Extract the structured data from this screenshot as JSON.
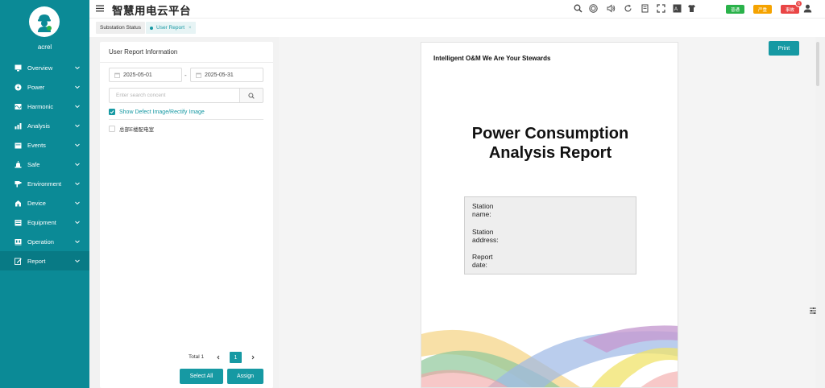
{
  "sidebar": {
    "username": "acrel",
    "items": [
      {
        "label": "Overview",
        "icon": "monitor-icon"
      },
      {
        "label": "Power",
        "icon": "power-icon"
      },
      {
        "label": "Harmonic",
        "icon": "harmonic-icon"
      },
      {
        "label": "Analysis",
        "icon": "bar-chart-icon"
      },
      {
        "label": "Events",
        "icon": "calendar-icon"
      },
      {
        "label": "Safe",
        "icon": "alarm-icon"
      },
      {
        "label": "Environment",
        "icon": "environment-icon"
      },
      {
        "label": "Device",
        "icon": "device-icon"
      },
      {
        "label": "Equipment",
        "icon": "equipment-icon"
      },
      {
        "label": "Operation",
        "icon": "operation-icon"
      },
      {
        "label": "Report",
        "icon": "edit-icon"
      }
    ],
    "active": "Report"
  },
  "header": {
    "title": "智慧用电云平台",
    "status_badges": [
      {
        "label": "普通",
        "color": "#2ab24a"
      },
      {
        "label": "严重",
        "color": "#f5a300"
      },
      {
        "label": "事故",
        "color": "#e94545"
      }
    ],
    "notification_count": "6"
  },
  "tabs": [
    {
      "label": "Substation Status"
    },
    {
      "label": "User Report"
    }
  ],
  "panel": {
    "title": "User Report Information",
    "start_date": "2025-05-01",
    "date_separator": "-",
    "end_date": "2025-05-31",
    "search_placeholder": "Enter search concent",
    "show_defect_label": "Show Defect Image/Rectify Image",
    "item_label": "总部E楼配电室",
    "pager": {
      "total": "Total 1",
      "page": "1"
    },
    "select_all_label": "Select All",
    "assign_label": "Assign"
  },
  "report": {
    "print_label": "Print",
    "slogan": "Intelligent O&M We Are Your Stewards",
    "title_line1": "Power Consumption",
    "title_line2": "Analysis Report",
    "station_name_1": "Station",
    "station_name_2": "name:",
    "station_address_1": "Station",
    "station_address_2": "address:",
    "report_date_1": "Report",
    "report_date_2": "date:"
  },
  "colors": {
    "sidebar_bg": "#0b8a96",
    "accent": "#1699a3"
  }
}
